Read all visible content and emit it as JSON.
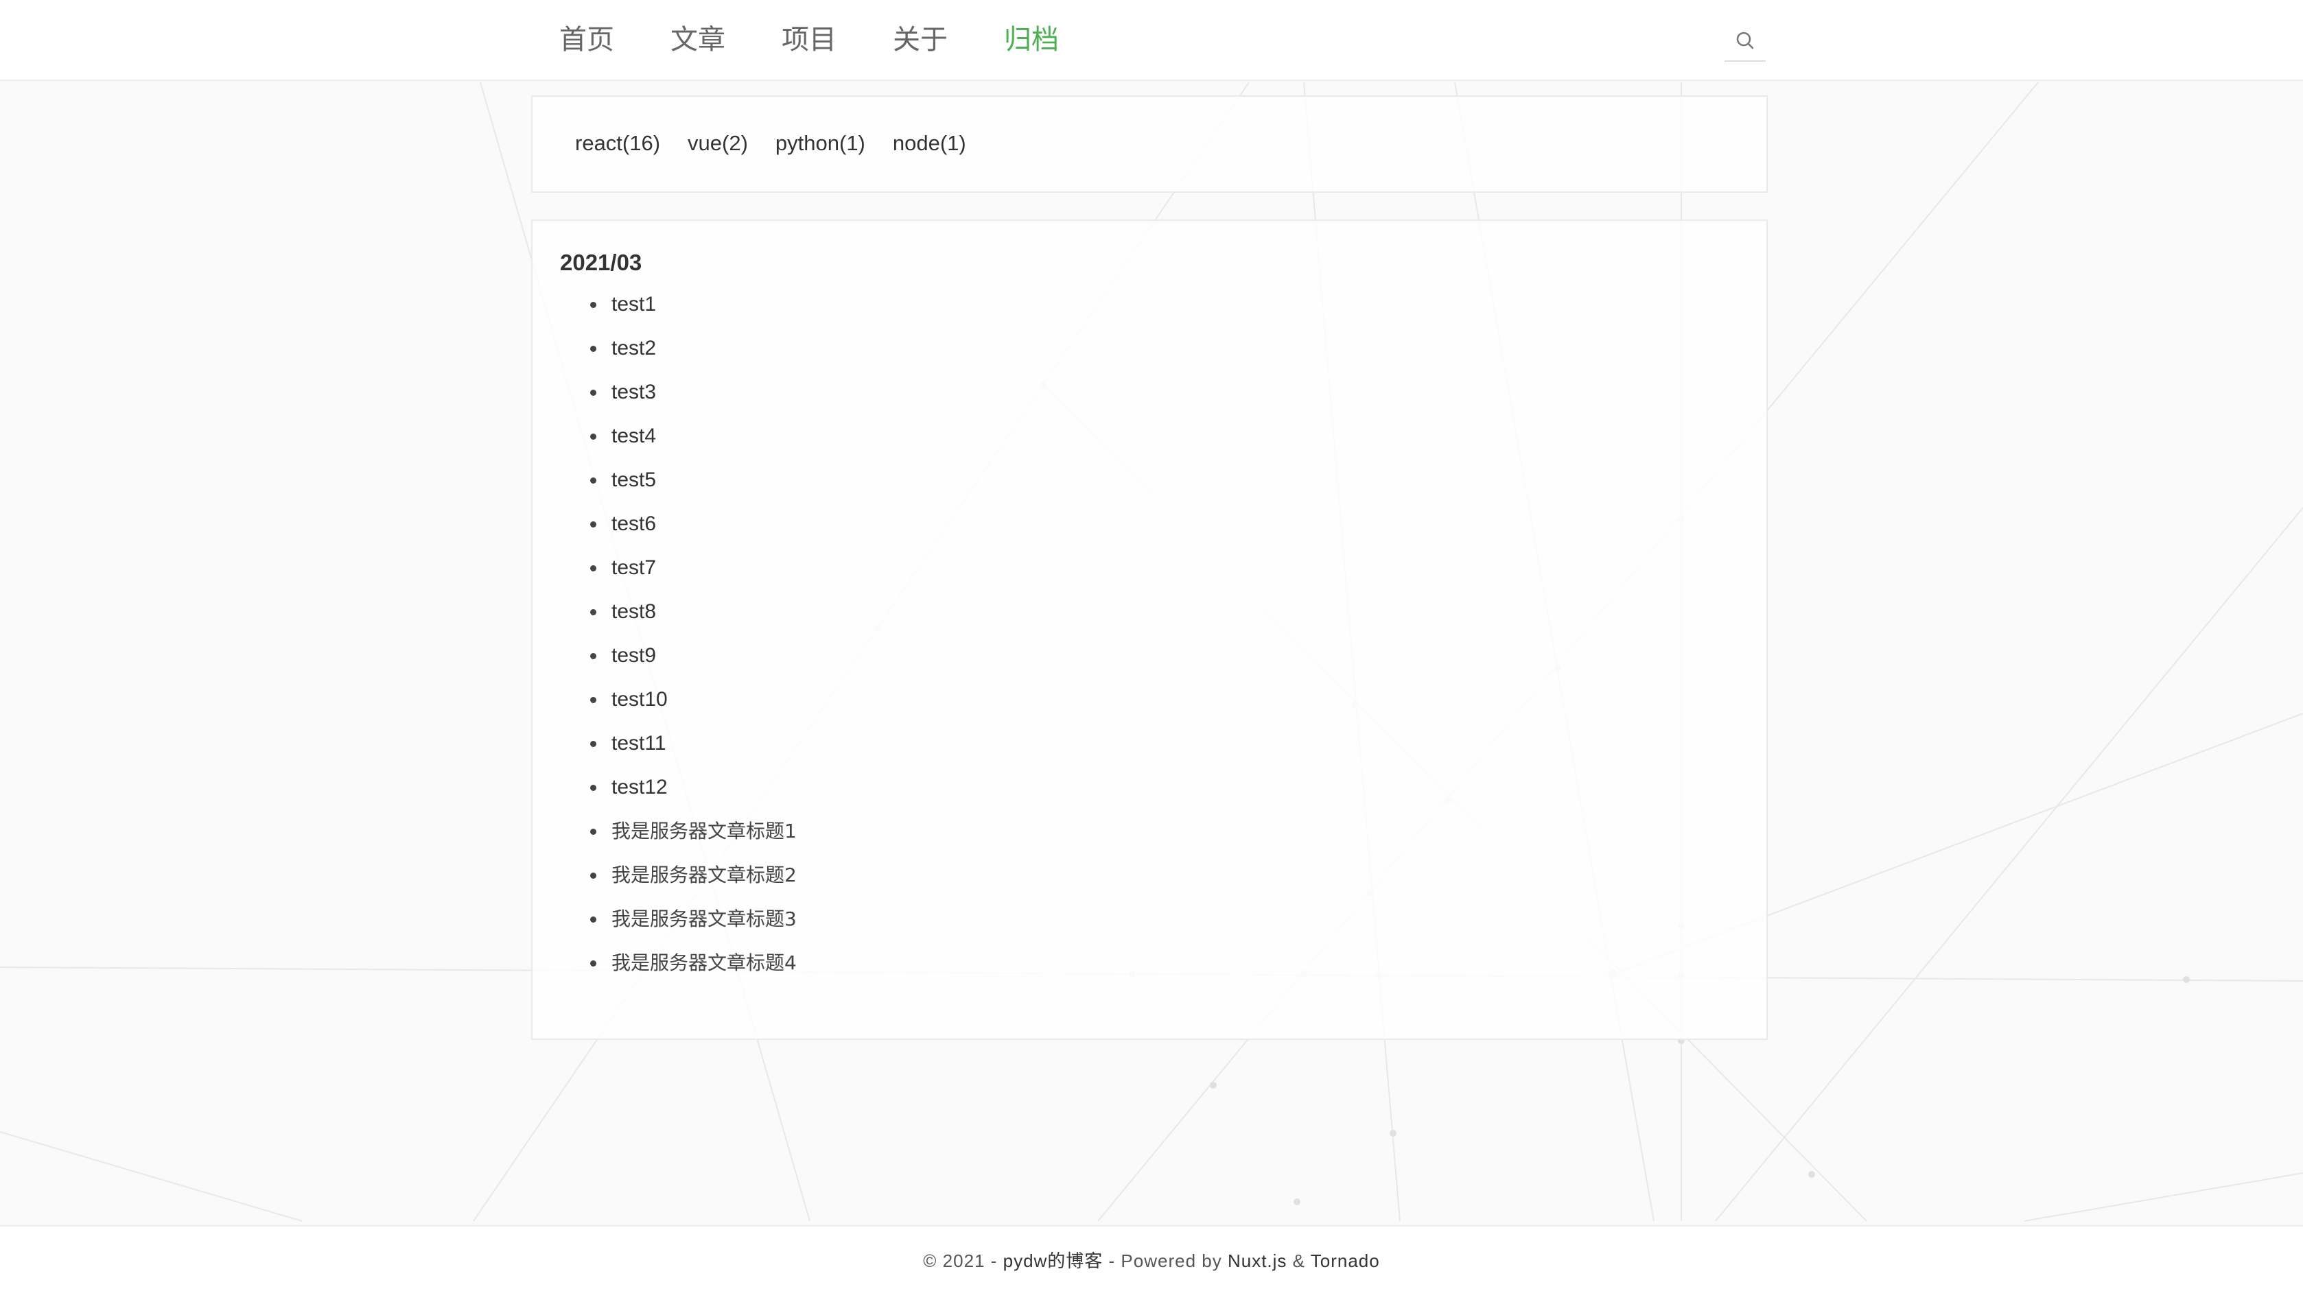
{
  "nav": {
    "items": [
      {
        "label": "首页",
        "active": false
      },
      {
        "label": "文章",
        "active": false
      },
      {
        "label": "项目",
        "active": false
      },
      {
        "label": "关于",
        "active": false
      },
      {
        "label": "归档",
        "active": true
      }
    ],
    "search_icon": "search-icon",
    "active_color": "#4caf50"
  },
  "tags": [
    {
      "label": "react(16)"
    },
    {
      "label": "vue(2)"
    },
    {
      "label": "python(1)"
    },
    {
      "label": "node(1)"
    }
  ],
  "archive": {
    "month": "2021/03",
    "posts": [
      {
        "title": "test1"
      },
      {
        "title": "test2"
      },
      {
        "title": "test3"
      },
      {
        "title": "test4"
      },
      {
        "title": "test5"
      },
      {
        "title": "test6"
      },
      {
        "title": "test7"
      },
      {
        "title": "test8"
      },
      {
        "title": "test9"
      },
      {
        "title": "test10"
      },
      {
        "title": "test11"
      },
      {
        "title": "test12"
      },
      {
        "title": "我是服务器文章标题1"
      },
      {
        "title": "我是服务器文章标题2"
      },
      {
        "title": "我是服务器文章标题3"
      },
      {
        "title": "我是服务器文章标题4"
      }
    ]
  },
  "footer": {
    "prefix": "© 2021 - ",
    "blog_name": "pydw的博客",
    "middle": " - Powered by ",
    "framework": "Nuxt.js",
    "amp": " & ",
    "server": "Tornado"
  }
}
